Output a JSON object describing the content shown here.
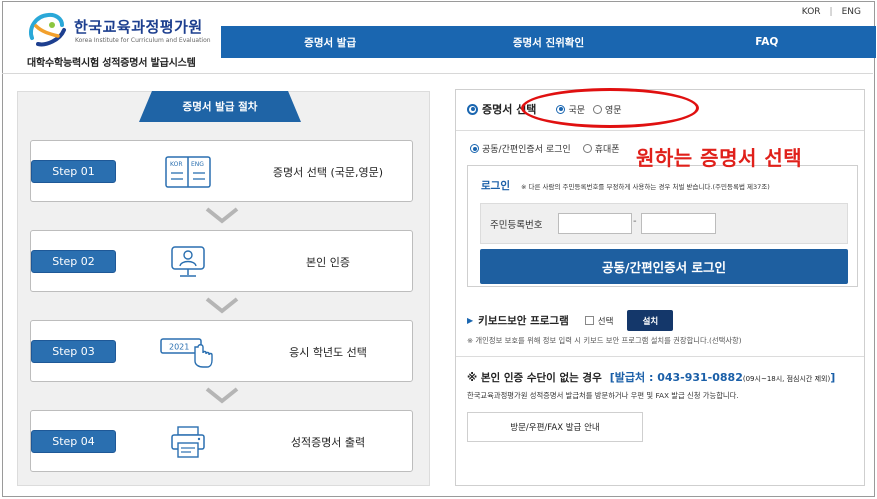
{
  "header": {
    "lang": {
      "kor": "KOR",
      "eng": "ENG"
    },
    "logo_name": "한국교육과정평가원",
    "logo_sub": "Korea Institute for Curriculum and Evaluation",
    "system_title": "대학수학능력시험 성적증명서 발급시스템",
    "nav": [
      "증명서 발급",
      "증명서 진위확인",
      "FAQ"
    ]
  },
  "procedure": {
    "tab_label": "증명서 발급 절차",
    "steps": [
      {
        "badge": "Step 01",
        "label": "증명서 선택 (국문,영문)",
        "icon": "kor-eng-book-icon",
        "icon_text": [
          "KOR",
          "ENG"
        ]
      },
      {
        "badge": "Step 02",
        "label": "본인 인증",
        "icon": "monitor-user-icon"
      },
      {
        "badge": "Step 03",
        "label": "응시 학년도 선택",
        "icon": "year-click-icon",
        "icon_text": [
          "2021"
        ]
      },
      {
        "badge": "Step 04",
        "label": "성적증명서 출력",
        "icon": "printer-icon"
      }
    ]
  },
  "certificate": {
    "title": "증명서 선택",
    "options": [
      {
        "label": "국문",
        "selected": true
      },
      {
        "label": "영문",
        "selected": false
      }
    ],
    "annotation": "원하는 증명서 선택"
  },
  "auth_method": {
    "options": [
      {
        "label": "공동/간편인증서 로그인",
        "selected": true
      },
      {
        "label": "휴대폰",
        "selected": false
      }
    ]
  },
  "login": {
    "title": "로그인",
    "note": "※ 다른 사람의 주민등록번호를 부정하게 사용하는 경우 처벌 받습니다.(주민등록법 제37조)",
    "rrn_label": "주민등록번호",
    "rrn_dash": "-",
    "button": "공동/간편인증서 로그인"
  },
  "keyboard": {
    "title": "키보드보안 프로그램",
    "check_label": "선택",
    "install_button": "설치",
    "note": "※ 개인정보 보호를 위해 정보 입력 시 키보드 보안 프로그램 설치를 권장합니다.(선택사항)"
  },
  "no_auth": {
    "title": "※ 본인 인증 수단이 없는 경우",
    "phone_prefix": "[발급처 : 043-931-0882",
    "hours": " (09시~18시, 점심시간 제외)",
    "phone_suffix": "]",
    "desc": "한국교육과정평가원 성적증명서 발급처를 방문하거나 우편 및 FAX 발급 신청 가능합니다.",
    "button": "방문/우편/FAX 발급 안내"
  },
  "colors": {
    "brand_blue": "#1a66b0",
    "annotation_red": "#e0201a",
    "dark_navy": "#14376a"
  }
}
